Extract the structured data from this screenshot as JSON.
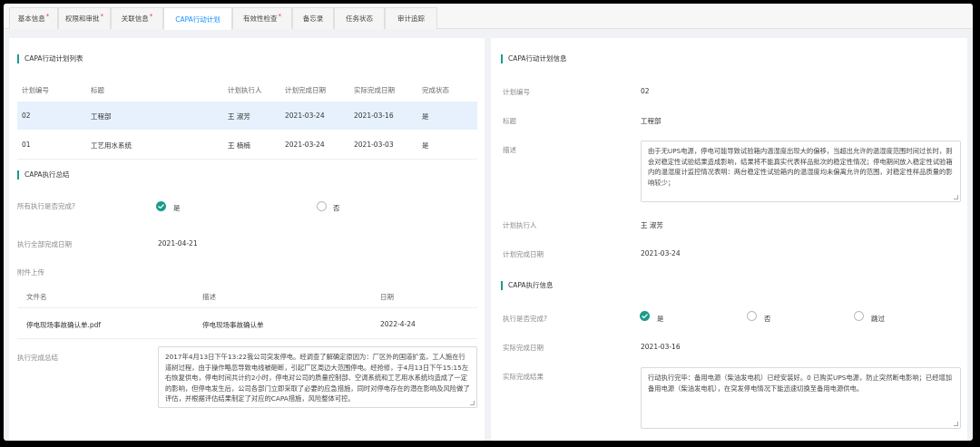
{
  "tabs": [
    {
      "label": "基本信息",
      "required": true
    },
    {
      "label": "权限和审批",
      "required": true
    },
    {
      "label": "关联信息",
      "required": true
    },
    {
      "label": "CAPA行动计划",
      "required": false,
      "active": true
    },
    {
      "label": "有效性检查",
      "required": true
    },
    {
      "label": "备忘录",
      "required": false
    },
    {
      "label": "任务状态",
      "required": false
    },
    {
      "label": "审计追踪",
      "required": false
    }
  ],
  "left": {
    "plan_list_title": "CAPA行动计划列表",
    "plan_table": {
      "headers": [
        "计划编号",
        "标题",
        "计划执行人",
        "计划完成日期",
        "实际完成日期",
        "完成状态"
      ],
      "rows": [
        [
          "02",
          "工程部",
          "王 淑芳",
          "2021-03-24",
          "2021-03-16",
          "是"
        ],
        [
          "01",
          "工艺用水系统",
          "王 楠楠",
          "2021-03-24",
          "2021-03-03",
          "是"
        ]
      ]
    },
    "summary_title": "CAPA执行总结",
    "all_done_label": "所有执行是否完成?",
    "opt_yes": "是",
    "opt_no": "否",
    "all_done_date_label": "执行全部完成日期",
    "all_done_date": "2021-04-21",
    "attach_label": "附件上传",
    "attach_table": {
      "headers": [
        "文件名",
        "描述",
        "日期"
      ],
      "rows": [
        [
          "停电现场事故确认单.pdf",
          "停电现场事故确认单",
          "2022-4-24"
        ]
      ]
    },
    "summary_label": "执行完成总结",
    "summary_text": "2017年4月13日下午13:22我公司突发停电。经调查了解确定原因为：厂区外的国道扩宽，工人施在行道树过程，由于操作略忽导致电线被砸断，引起厂区周边大范围停电。经抢修，于4月13日下午15:15左右恢复供电，停电时间共计约2小时，停电对公司的质量控制部、空调系统和工艺用水系统均造成了一定的影响，但停电发生后，公司各部门立即采取了必要的应急措施，同时对停电存在的潜在影响及风险做了评估，并根据评估结果制定了对应的CAPA措施，风险整体可控。"
  },
  "right": {
    "plan_info_title": "CAPA行动计划信息",
    "plan_no_label": "计划编号",
    "plan_no": "02",
    "title_label": "标题",
    "title_value": "工程部",
    "desc_label": "描述",
    "desc_text": "由于无UPS电源，停电可能导致试验箱内温湿度出现大的偏移，当超出允许的温湿度范围时间过长时，则会对稳定性试验结果造成影响，结果将不能真实代表样品批次的稳定性情况；停电期间放入稳定性试验箱内的温湿度计监控情况表明：两台稳定性试验箱内的温湿度均未偏离允许的范围，对稳定性样品质量的影响较少；",
    "executor_label": "计划执行人",
    "executor": "王 淑芳",
    "plan_date_label": "计划完成日期",
    "plan_date": "2021-03-24",
    "exec_info_title": "CAPA执行信息",
    "exec_done_label": "执行是否完成?",
    "opt_yes": "是",
    "opt_no": "否",
    "opt_skip": "跳过",
    "actual_date_label": "实际完成日期",
    "actual_date": "2021-03-16",
    "result_label": "实际完成结果",
    "result_text": "行动执行完毕：备用电源（柴油发电机）已经安装好。0 已购买UPS电源，防止突然断电影响；已经增加备用电源（柴油发电机），在突发停电情况下能迅速切换至备用电源供电。"
  },
  "colors": {
    "accent": "#1a9b8a",
    "active_tab": "#1890ff",
    "row_highlight": "#e6f1fd"
  }
}
